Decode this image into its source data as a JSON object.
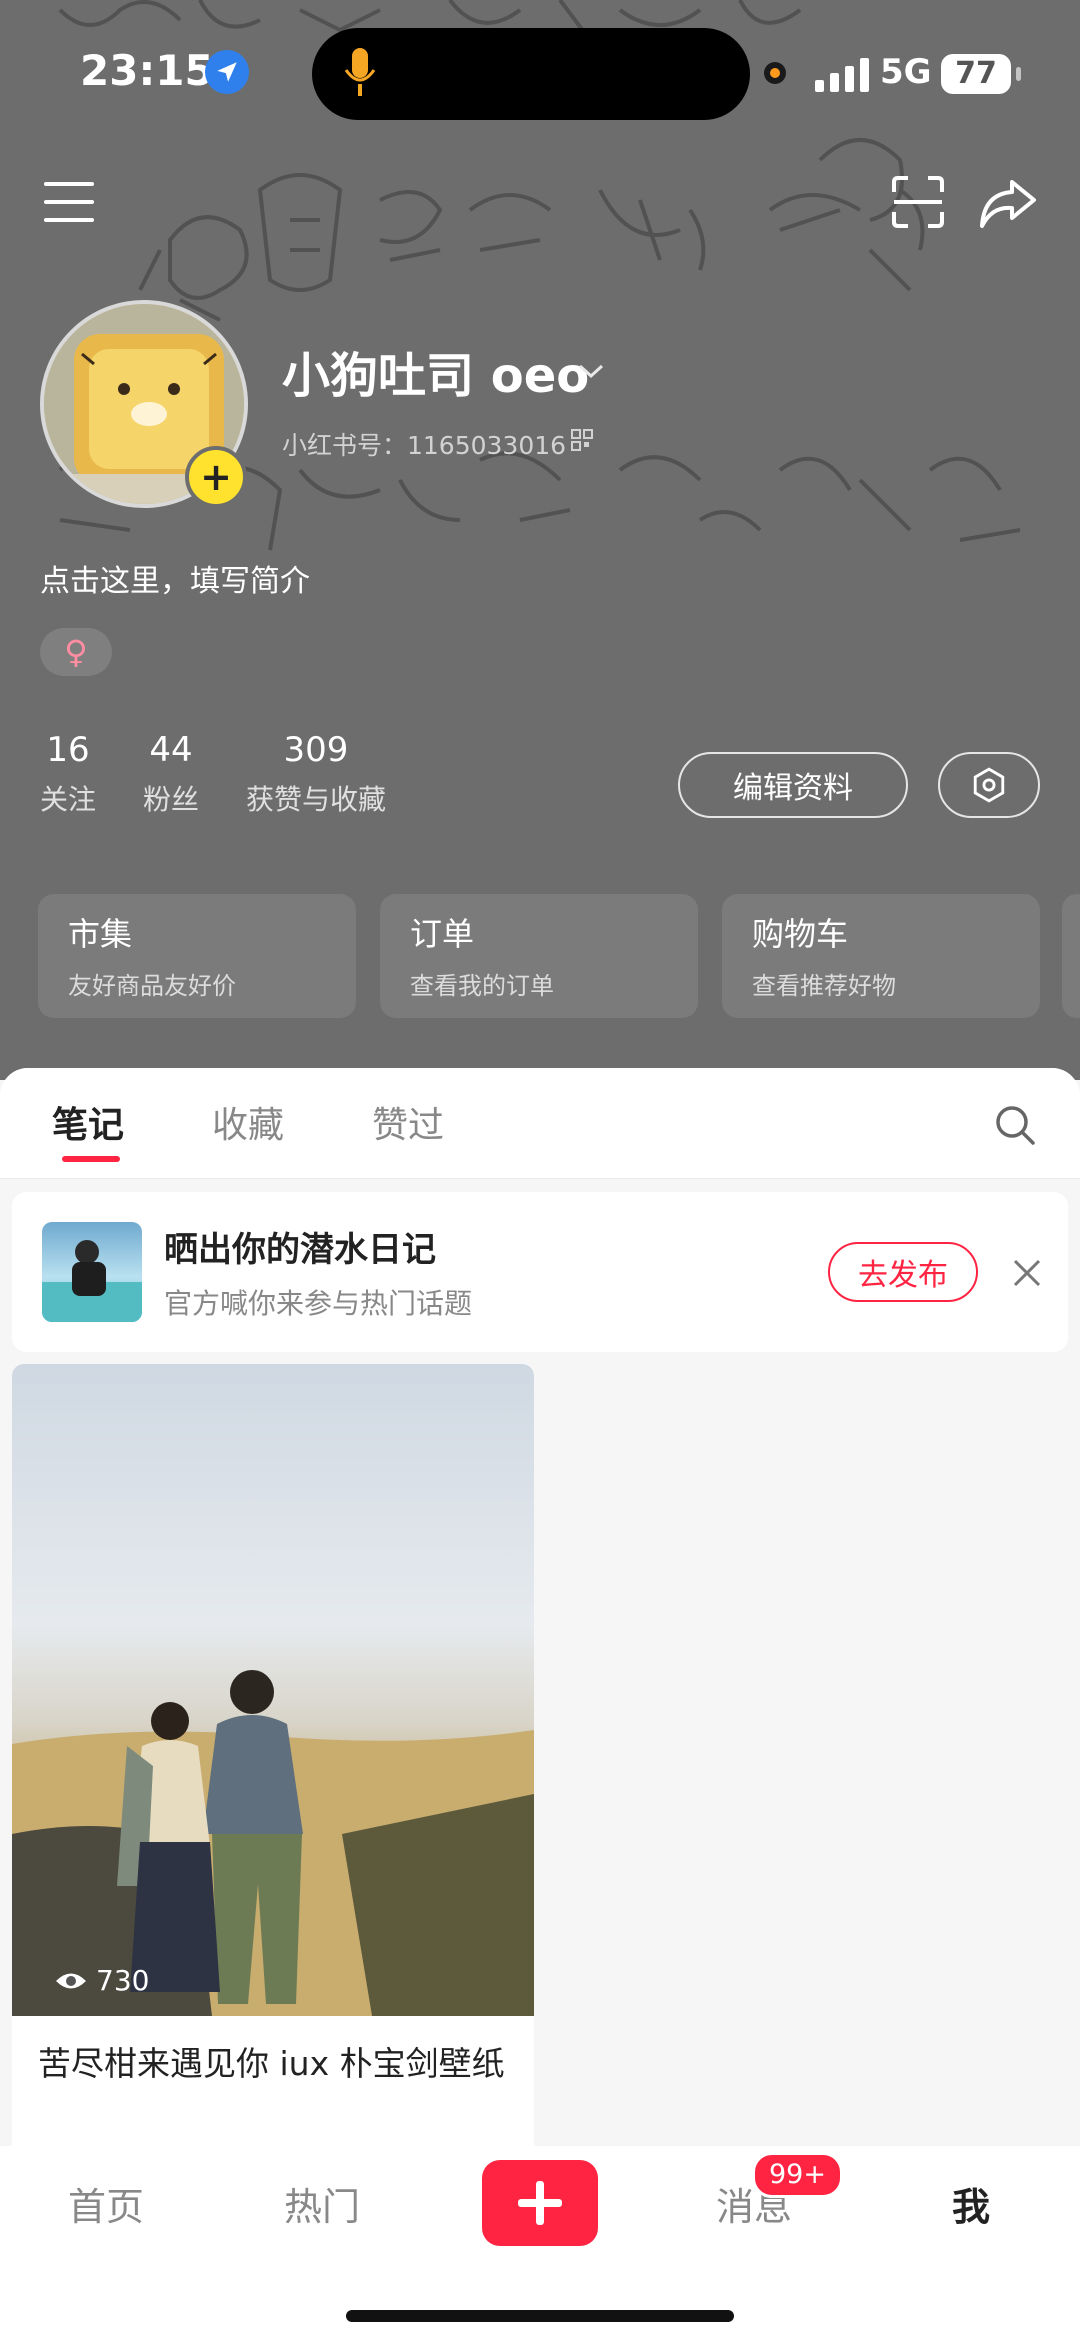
{
  "status_bar": {
    "time": "23:15",
    "network": "5G",
    "battery": "77"
  },
  "profile": {
    "name": "小狗吐司 oeo",
    "id_text": "小红书号：1165033016",
    "bio": "点击这里，填写简介",
    "gender_symbol": "♀"
  },
  "stats": [
    {
      "value": "16",
      "label": "关注"
    },
    {
      "value": "44",
      "label": "粉丝"
    },
    {
      "value": "309",
      "label": "获赞与收藏"
    }
  ],
  "buttons": {
    "edit_profile": "编辑资料"
  },
  "cards": [
    {
      "title": "市集",
      "subtitle": "友好商品友好价"
    },
    {
      "title": "订单",
      "subtitle": "查看我的订单"
    },
    {
      "title": "购物车",
      "subtitle": "查看推荐好物"
    }
  ],
  "tabs": [
    {
      "label": "笔记",
      "active": true
    },
    {
      "label": "收藏",
      "active": false
    },
    {
      "label": "赞过",
      "active": false
    }
  ],
  "promo": {
    "title": "晒出你的潜水日记",
    "subtitle": "官方喊你来参与热门话题",
    "button": "去发布"
  },
  "note": {
    "views": "730",
    "title": "苦尽柑来遇见你 iux 朴宝剑壁纸"
  },
  "bottom_nav": {
    "home": "首页",
    "hot": "热门",
    "messages": "消息",
    "messages_badge": "99+",
    "me": "我"
  },
  "colors": {
    "accent": "#ff2442",
    "header_bg": "#6d6d6d",
    "avatar_plus": "#ffe22d"
  },
  "icons": [
    "location-arrow-icon",
    "microphone-icon",
    "signal-icon",
    "menu-icon",
    "scan-icon",
    "share-icon",
    "chevron-down-icon",
    "qr-code-icon",
    "gear-icon",
    "search-icon",
    "close-icon",
    "eye-icon",
    "plus-icon"
  ]
}
